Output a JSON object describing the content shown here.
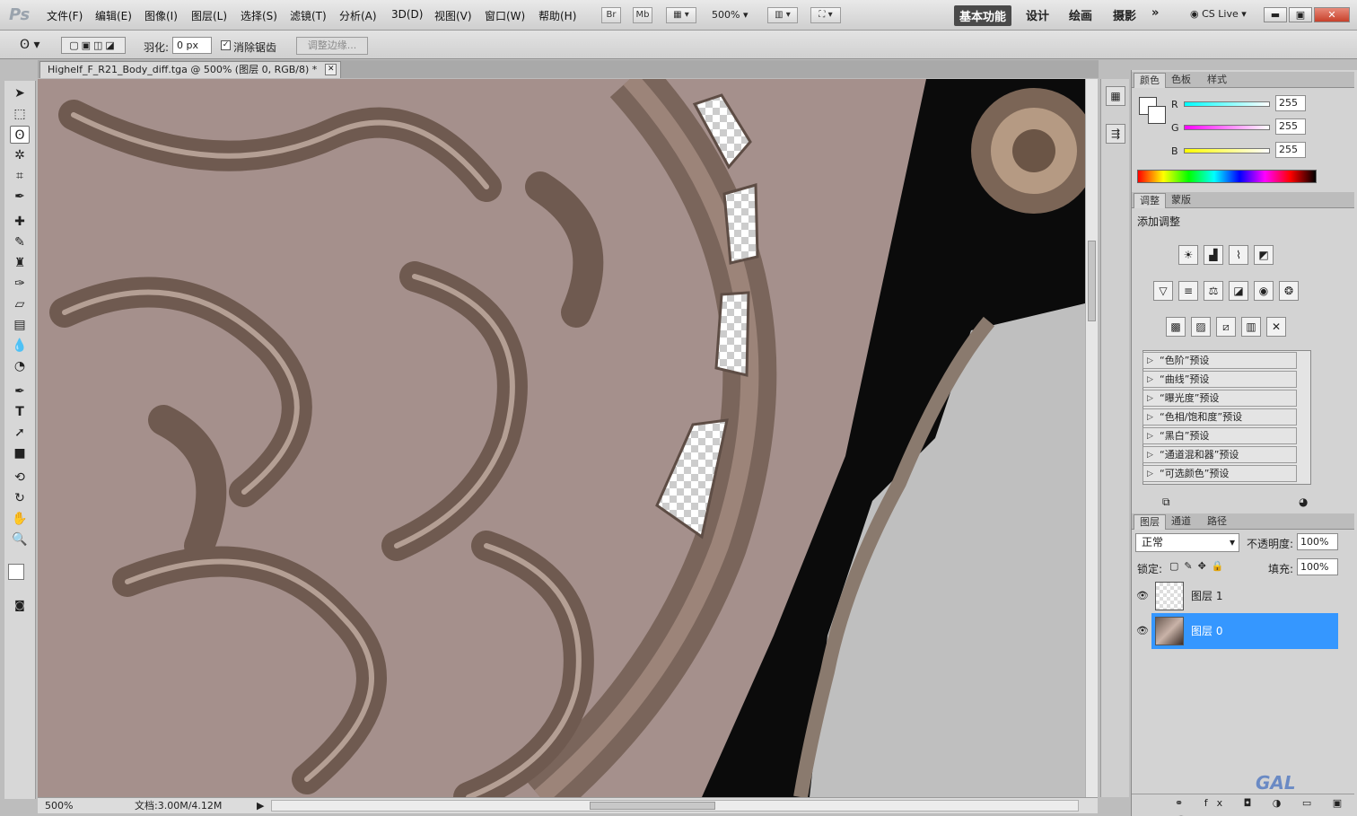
{
  "app": {
    "logo": "Ps",
    "window_title": "Highelf_F_R21_Body_diff.tga @ 500% (图层 0, RGB/8) *"
  },
  "menus": [
    "文件(F)",
    "编辑(E)",
    "图像(I)",
    "图层(L)",
    "选择(S)",
    "滤镜(T)",
    "分析(A)",
    "3D(D)",
    "视图(V)",
    "窗口(W)",
    "帮助(H)"
  ],
  "appbar": {
    "br": "Br",
    "mb": "Mb",
    "zoom": "500%",
    "cs_live": "CS Live",
    "workspaces": [
      "基本功能",
      "设计",
      "绘画",
      "摄影"
    ],
    "more": "»"
  },
  "options": {
    "feather_label": "羽化:",
    "feather_value": "0 px",
    "antialias_label": "消除锯齿",
    "antialias_checked": true,
    "refine_edge": "调整边缘..."
  },
  "tools": [
    "move-icon",
    "marquee-icon",
    "lasso-icon",
    "magic-wand-icon",
    "crop-icon",
    "eyedropper-icon",
    "healing-icon",
    "brush-icon",
    "stamp-icon",
    "history-brush-icon",
    "eraser-icon",
    "gradient-icon",
    "blur-icon",
    "dodge-icon",
    "pen-icon",
    "type-icon",
    "path-select-icon",
    "shape-icon",
    "3d-rotate-icon",
    "3d-orbit-icon",
    "hand-icon",
    "zoom-icon"
  ],
  "color_panel": {
    "tabs": [
      "颜色",
      "色板",
      "样式"
    ],
    "r": "255",
    "g": "255",
    "b": "255",
    "r_label": "R",
    "g_label": "G",
    "b_label": "B"
  },
  "adjust_panel": {
    "tabs": [
      "调整",
      "蒙版"
    ],
    "heading": "添加调整",
    "presets": [
      "“色阶”预设",
      "“曲线”预设",
      "“曝光度”预设",
      "“色相/饱和度”预设",
      "“黑白”预设",
      "“通道混和器”预设",
      "“可选颜色”预设"
    ]
  },
  "layers_panel": {
    "tabs": [
      "图层",
      "通道",
      "路径"
    ],
    "blend_mode": "正常",
    "opacity_label": "不透明度:",
    "opacity": "100%",
    "lock_label": "锁定:",
    "fill_label": "填充:",
    "fill": "100%",
    "layers": [
      {
        "name": "图层 1",
        "selected": false
      },
      {
        "name": "图层 0",
        "selected": true
      }
    ]
  },
  "status": {
    "zoom": "500%",
    "doc": "文档:3.00M/4.12M"
  },
  "watermark": "GAL"
}
